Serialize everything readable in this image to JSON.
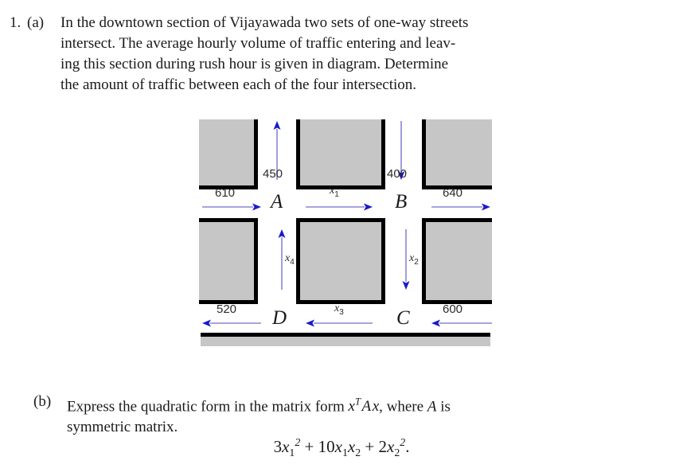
{
  "problem_a": {
    "number": "1.",
    "letter": "(a)",
    "lines": [
      "In the downtown section of Vijayawada two sets of one-way streets",
      "intersect.  The average hourly volume of traffic entering and leav-",
      "ing this section during rush hour is given in diagram.  Determine",
      "the amount of traffic between each of the four intersection."
    ]
  },
  "problem_b": {
    "letter": "(b)",
    "lines_pre": "Express the quadratic form in the matrix form ",
    "math_inline": "xᵀAx",
    "lines_mid": ", where ",
    "math_A": "A",
    "lines_post": " is",
    "line2": "symmetric matrix.",
    "equation": "3x₁² + 10x₁x₂ + 2x₂²."
  },
  "diagram": {
    "colors": {
      "block_fill": "#c6c6c6",
      "block_border": "#000000",
      "arrow_line": "#8a86d4",
      "arrow_head": "#1a1ac8",
      "label_text": "#2b2b2b"
    },
    "nodes": [
      {
        "id": "A",
        "label": "A"
      },
      {
        "id": "B",
        "label": "B"
      },
      {
        "id": "C",
        "label": "C"
      },
      {
        "id": "D",
        "label": "D"
      }
    ],
    "flows": [
      {
        "id": "in-610",
        "label": "610",
        "direction": "right",
        "kind": "known"
      },
      {
        "id": "in-450",
        "label": "450",
        "direction": "up",
        "kind": "known"
      },
      {
        "id": "out-400",
        "label": "400",
        "direction": "down",
        "kind": "known"
      },
      {
        "id": "out-640",
        "label": "640",
        "direction": "right",
        "kind": "known"
      },
      {
        "id": "x1",
        "label": "x1",
        "direction": "right",
        "kind": "unknown"
      },
      {
        "id": "x2",
        "label": "x2",
        "direction": "down",
        "kind": "unknown"
      },
      {
        "id": "x3",
        "label": "x3",
        "direction": "left",
        "kind": "unknown"
      },
      {
        "id": "x4",
        "label": "x4",
        "direction": "up",
        "kind": "unknown"
      },
      {
        "id": "out-520",
        "label": "520",
        "direction": "left",
        "kind": "known"
      },
      {
        "id": "in-600",
        "label": "600",
        "direction": "left",
        "kind": "known"
      }
    ]
  }
}
